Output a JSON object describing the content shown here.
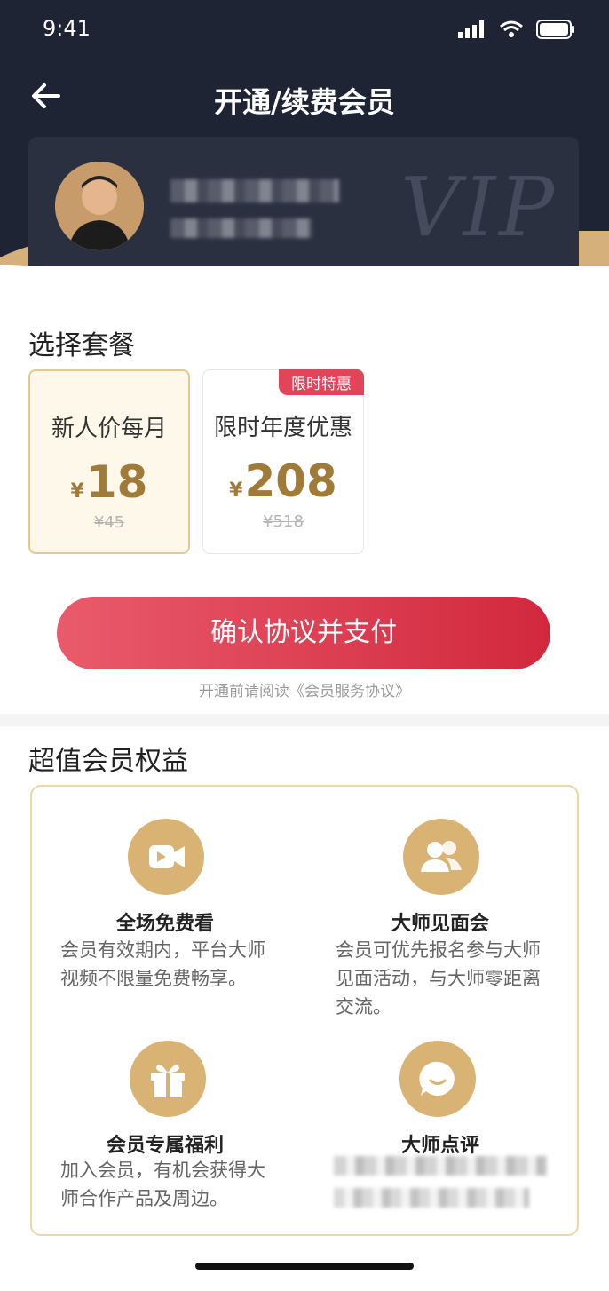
{
  "status_bar": {
    "time": "9:41"
  },
  "nav": {
    "title": "开通/续费会员"
  },
  "vip_card": {
    "watermark": "VIP"
  },
  "plans_section": {
    "title": "选择套餐",
    "plans": [
      {
        "name": "新人价每月",
        "currency": "¥",
        "price": "18",
        "original": "¥45"
      },
      {
        "name": "限时年度优惠",
        "currency": "¥",
        "price": "208",
        "original": "¥518",
        "badge": "限时特惠"
      }
    ]
  },
  "pay": {
    "button": "确认协议并支付",
    "agreement": "开通前请阅读《会员服务协议》"
  },
  "benefits": {
    "title": "超值会员权益",
    "items": [
      {
        "name": "全场免费看",
        "desc": "会员有效期内，平台大师视频不限量免费畅享。",
        "icon": "video-icon"
      },
      {
        "name": "大师见面会",
        "desc": "会员可优先报名参与大师见面活动，与大师零距离交流。",
        "icon": "users-icon"
      },
      {
        "name": "会员专属福利",
        "desc": "加入会员，有机会获得大师合作产品及周边。",
        "icon": "gift-icon"
      },
      {
        "name": "大师点评",
        "desc": "",
        "icon": "chat-icon"
      }
    ]
  }
}
